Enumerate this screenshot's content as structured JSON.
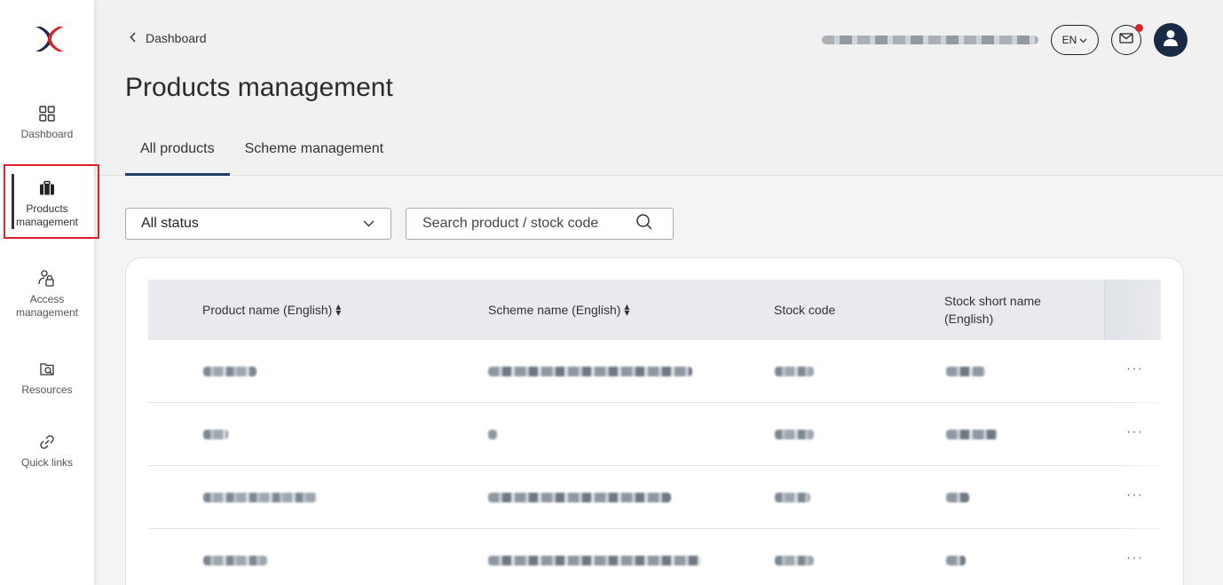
{
  "sidebar": {
    "items": [
      {
        "label": "Dashboard",
        "icon": "grid-icon"
      },
      {
        "label": "Products\nmanagement",
        "icon": "briefcase-icon",
        "active": true
      },
      {
        "label": "Access\nmanagement",
        "icon": "user-lock-icon"
      },
      {
        "label": "Resources",
        "icon": "folder-search-icon"
      },
      {
        "label": "Quick links",
        "icon": "link-icon"
      }
    ]
  },
  "header": {
    "breadcrumb": "Dashboard",
    "title": "Products management",
    "language": "EN",
    "tabs": [
      {
        "label": "All products",
        "active": true
      },
      {
        "label": "Scheme management",
        "active": false
      }
    ]
  },
  "filters": {
    "status_selected": "All status",
    "search_placeholder": "Search product / stock code"
  },
  "table": {
    "columns": [
      "Product name (English)",
      "Scheme name (English)",
      "Stock code",
      "Stock short name (English)"
    ],
    "row_count": 4,
    "row_action": "···"
  },
  "colors": {
    "accent": "#1e3c64",
    "highlight": "#d8232a",
    "brand_red": "#d8232a",
    "brand_navy": "#1a2a44"
  }
}
